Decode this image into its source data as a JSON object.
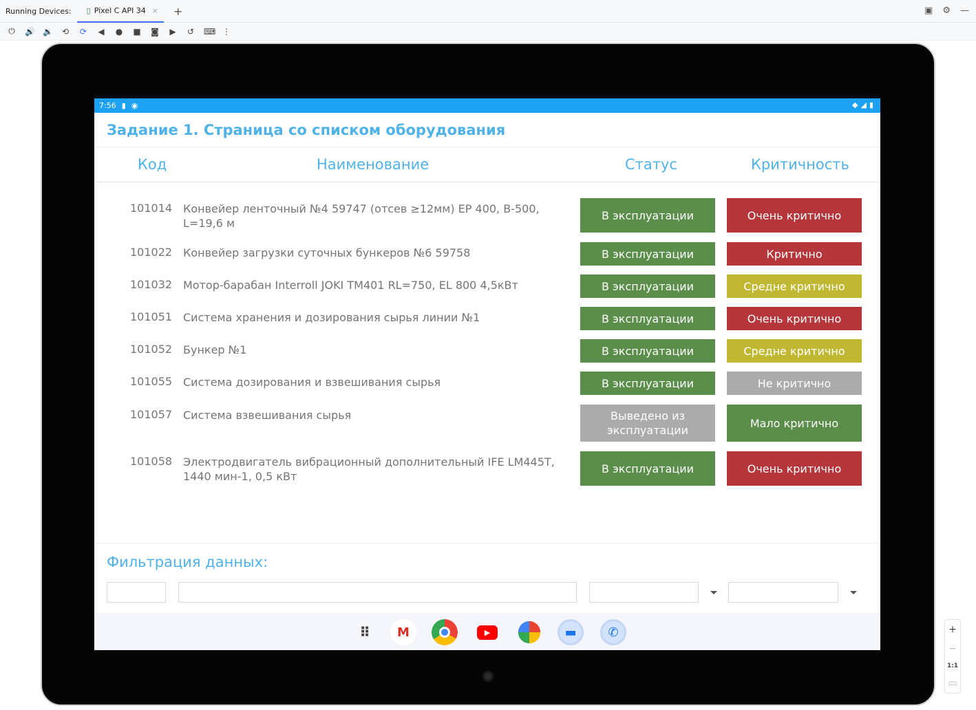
{
  "ide": {
    "running_devices_label": "Running Devices:",
    "device_tab_label": "Pixel C API 34",
    "tab_close": "×",
    "add_tab": "+"
  },
  "statusbar": {
    "time": "7:56"
  },
  "app": {
    "title": "Задание 1. Страница со списком оборудования",
    "columns": {
      "code": "Код",
      "name": "Наименование",
      "status": "Статус",
      "criticality": "Критичность"
    },
    "rows": [
      {
        "code": "101014",
        "name": "Конвейер ленточный №4 59747 (отсев ≥12мм) EP 400, B-500, L=19,6 м",
        "status": "В эксплуатации",
        "criticality": "Очень критично"
      },
      {
        "code": "101022",
        "name": "Конвейер загрузки суточных бункеров  №6 59758",
        "status": "В эксплуатации",
        "criticality": "Критично"
      },
      {
        "code": "101032",
        "name": "Мотор-барабан Interroll JOKI TM401 RL=750, EL 800 4,5кВт",
        "status": "В эксплуатации",
        "criticality": "Средне критично"
      },
      {
        "code": "101051",
        "name": "Система хранения и дозирования сырья линии  №1",
        "status": "В эксплуатации",
        "criticality": "Очень критично"
      },
      {
        "code": "101052",
        "name": "Бункер  №1",
        "status": "В эксплуатации",
        "criticality": "Средне критично"
      },
      {
        "code": "101055",
        "name": "Система дозирования и взвешивания сырья",
        "status": "В эксплуатации",
        "criticality": "Не критично"
      },
      {
        "code": "101057",
        "name": "Система взвешивания сырья",
        "status": "Выведено из эксплуатации",
        "criticality": "Мало критично"
      },
      {
        "code": "101058",
        "name": "Электродвигатель вибрационный дополнительный IFE LM445T, 1440 мин-1, 0,5 кВт",
        "status": "В эксплуатации",
        "criticality": "Очень критично"
      }
    ],
    "filter_title": "Фильтрация данных:"
  },
  "colors": {
    "accent": "#4fb3e8",
    "status_bar": "#1da1f2",
    "in_operation": "#5b8e4a",
    "decommissioned": "#ababab",
    "very_critical": "#b5363b",
    "critical": "#b5363b",
    "medium_critical": "#c0b832",
    "not_critical": "#ababab",
    "low_critical": "#5b8e4a"
  },
  "dock_icons": [
    "apps-grid-icon",
    "gmail-icon",
    "chrome-icon",
    "youtube-icon",
    "photos-icon",
    "messages-icon",
    "phone-icon"
  ],
  "zoom": {
    "plus": "+",
    "minus": "−",
    "actual": "1:1"
  }
}
